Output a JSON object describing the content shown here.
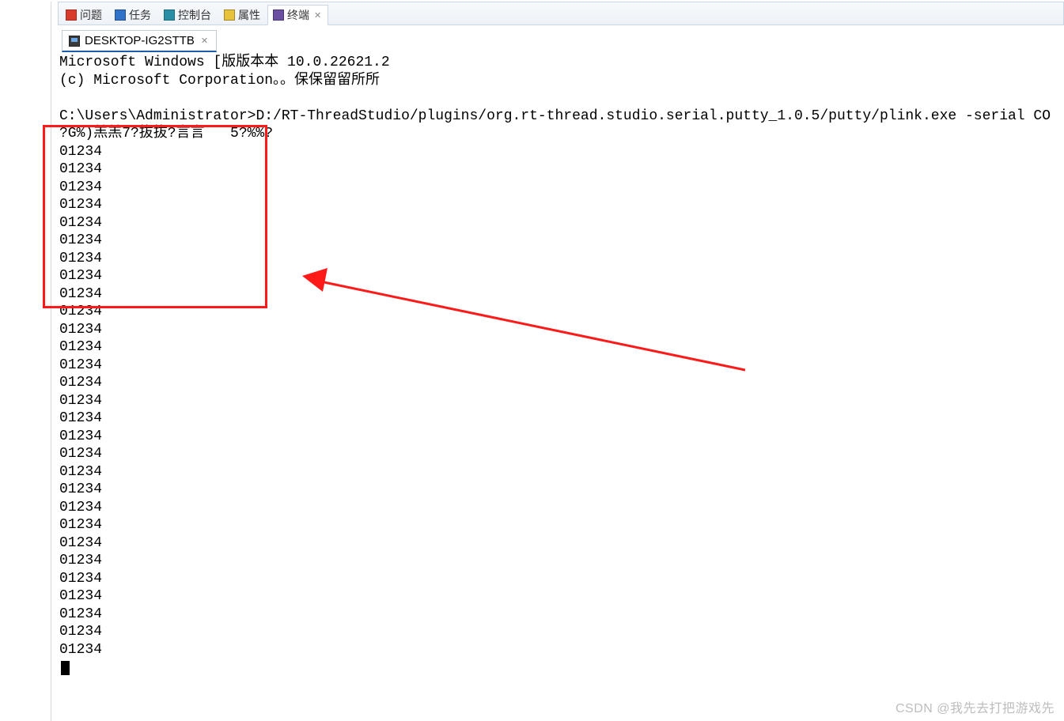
{
  "view_tabs": [
    {
      "icon": "red",
      "label": "问题"
    },
    {
      "icon": "blue",
      "label": "任务"
    },
    {
      "icon": "teal",
      "label": "控制台"
    },
    {
      "icon": "yellow",
      "label": "属性"
    },
    {
      "icon": "purple",
      "label": "终端",
      "active": true,
      "closable": true
    }
  ],
  "session_tab": {
    "icon": "mon",
    "label": "DESKTOP-IG2STTB",
    "closable": true
  },
  "terminal": {
    "head1": "Microsoft Windows [版版本本 10.0.22621.2",
    "head2": "(c) Microsoft Corporation。。保保留留所所",
    "blank": "",
    "cmd": "C:\\Users\\Administrator>D:/RT-ThreadStudio/plugins/org.rt-thread.studio.serial.putty_1.0.5/putty/plink.exe -serial CO",
    "garble": "?G%)羔羔7?抜抜?言言   5?%%?",
    "repeat_value": "01234",
    "repeat_count": 29
  },
  "watermark": "CSDN @我先去打把游戏先"
}
